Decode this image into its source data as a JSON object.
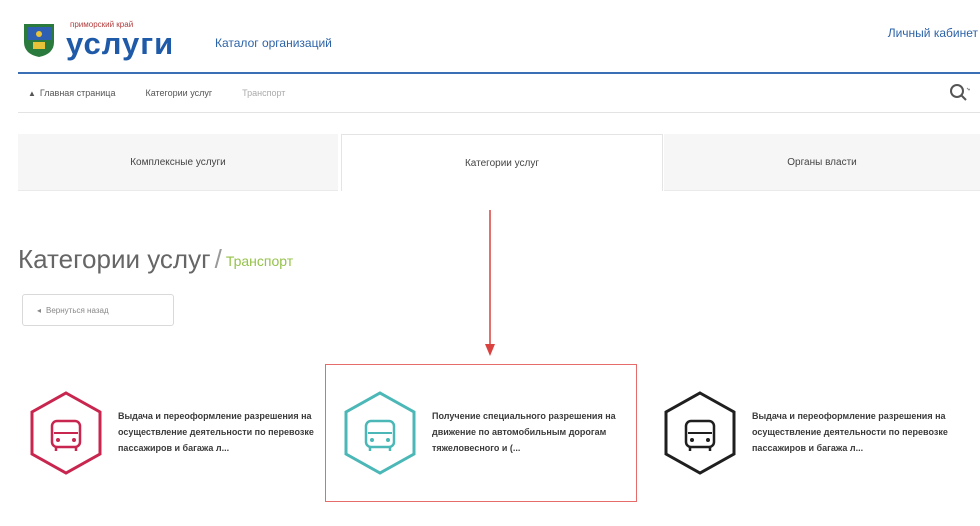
{
  "header": {
    "logo_small": "приморский край",
    "logo_big": "услуги",
    "catalog_link": "Каталог организаций",
    "cabinet_link": "Личный кабинет"
  },
  "breadcrumbs": [
    "Главная страница",
    "Категории услуг",
    "Транспорт"
  ],
  "tabs": [
    "Комплексные услуги",
    "Категории услуг",
    "Органы власти"
  ],
  "page": {
    "title": "Категории услуг",
    "separator": "/",
    "subtitle": "Транспорт",
    "back_button": "Вернуться назад"
  },
  "cards": [
    {
      "text": "Выдача и переоформление разрешения на осуществление деятельности по перевозке пассажиров и багажа л...",
      "icon": "car-icon",
      "color": "#c8264f"
    },
    {
      "text": "Получение специального разрешения на движение по автомобильным дорогам тяжеловесного и (...",
      "icon": "car-icon",
      "color": "#4bb7b7"
    },
    {
      "text": "Выдача и переоформление разрешения на осуществление деятельности по перевозке пассажиров и багажа л...",
      "icon": "car-icon",
      "color": "#1f1f1f"
    }
  ],
  "colors": {
    "brand": "#1e5aa8",
    "header_line": "#3a6fb6",
    "highlight": "#e66b6b",
    "subtitle": "#95c24a"
  }
}
